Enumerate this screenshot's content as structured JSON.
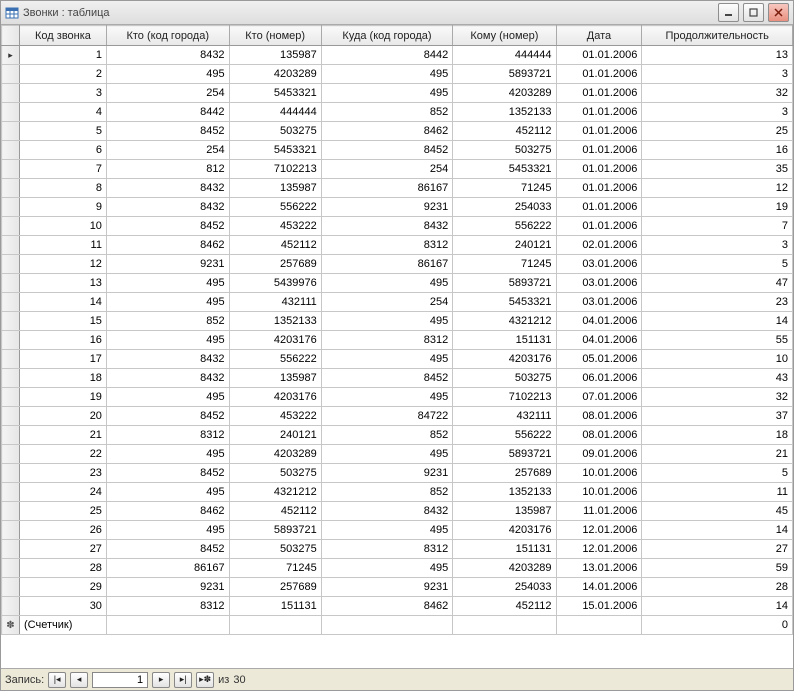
{
  "title": "Звонки : таблица",
  "columns": [
    "Код звонка",
    "Кто (код города)",
    "Кто (номер)",
    "Куда (код города)",
    "Кому (номер)",
    "Дата",
    "Продолжительность"
  ],
  "rows": [
    [
      1,
      8432,
      135987,
      8442,
      444444,
      "01.01.2006",
      13
    ],
    [
      2,
      495,
      4203289,
      495,
      5893721,
      "01.01.2006",
      3
    ],
    [
      3,
      254,
      5453321,
      495,
      4203289,
      "01.01.2006",
      32
    ],
    [
      4,
      8442,
      444444,
      852,
      1352133,
      "01.01.2006",
      3
    ],
    [
      5,
      8452,
      503275,
      8462,
      452112,
      "01.01.2006",
      25
    ],
    [
      6,
      254,
      5453321,
      8452,
      503275,
      "01.01.2006",
      16
    ],
    [
      7,
      812,
      7102213,
      254,
      5453321,
      "01.01.2006",
      35
    ],
    [
      8,
      8432,
      135987,
      86167,
      71245,
      "01.01.2006",
      12
    ],
    [
      9,
      8432,
      556222,
      9231,
      254033,
      "01.01.2006",
      19
    ],
    [
      10,
      8452,
      453222,
      8432,
      556222,
      "01.01.2006",
      7
    ],
    [
      11,
      8462,
      452112,
      8312,
      240121,
      "02.01.2006",
      3
    ],
    [
      12,
      9231,
      257689,
      86167,
      71245,
      "03.01.2006",
      5
    ],
    [
      13,
      495,
      5439976,
      495,
      5893721,
      "03.01.2006",
      47
    ],
    [
      14,
      495,
      432111,
      254,
      5453321,
      "03.01.2006",
      23
    ],
    [
      15,
      852,
      1352133,
      495,
      4321212,
      "04.01.2006",
      14
    ],
    [
      16,
      495,
      4203176,
      8312,
      151131,
      "04.01.2006",
      55
    ],
    [
      17,
      8432,
      556222,
      495,
      4203176,
      "05.01.2006",
      10
    ],
    [
      18,
      8432,
      135987,
      8452,
      503275,
      "06.01.2006",
      43
    ],
    [
      19,
      495,
      4203176,
      495,
      7102213,
      "07.01.2006",
      32
    ],
    [
      20,
      8452,
      453222,
      84722,
      432111,
      "08.01.2006",
      37
    ],
    [
      21,
      8312,
      240121,
      852,
      556222,
      "08.01.2006",
      18
    ],
    [
      22,
      495,
      4203289,
      495,
      5893721,
      "09.01.2006",
      21
    ],
    [
      23,
      8452,
      503275,
      9231,
      257689,
      "10.01.2006",
      5
    ],
    [
      24,
      495,
      4321212,
      852,
      1352133,
      "10.01.2006",
      11
    ],
    [
      25,
      8462,
      452112,
      8432,
      135987,
      "11.01.2006",
      45
    ],
    [
      26,
      495,
      5893721,
      495,
      4203176,
      "12.01.2006",
      14
    ],
    [
      27,
      8452,
      503275,
      8312,
      151131,
      "12.01.2006",
      27
    ],
    [
      28,
      86167,
      71245,
      495,
      4203289,
      "13.01.2006",
      59
    ],
    [
      29,
      9231,
      257689,
      9231,
      254033,
      "14.01.2006",
      28
    ],
    [
      30,
      8312,
      151131,
      8462,
      452112,
      "15.01.2006",
      14
    ]
  ],
  "counter_label": "(Счетчик)",
  "new_row_duration": 0,
  "nav": {
    "label": "Запись:",
    "current": "1",
    "of_label": "из",
    "total": "30"
  }
}
